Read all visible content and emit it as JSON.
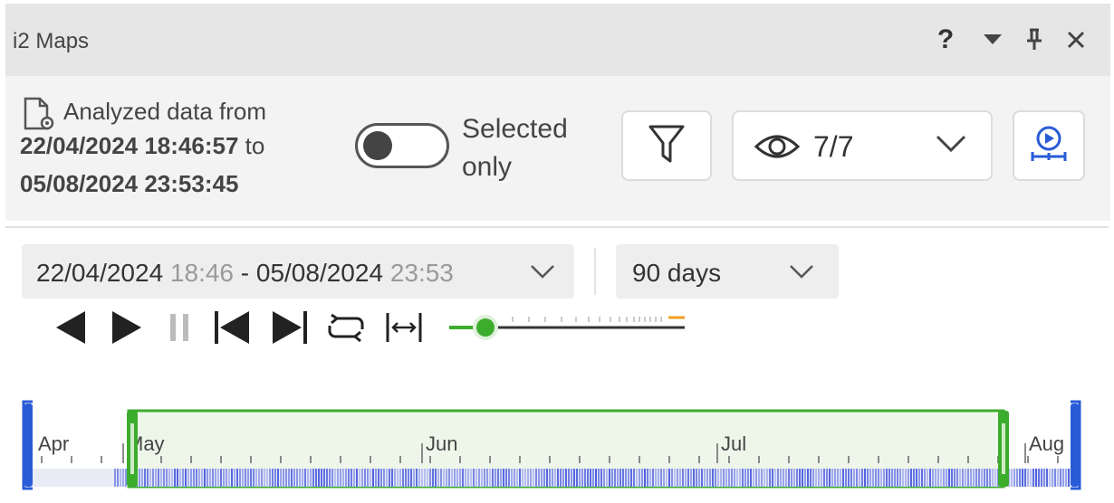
{
  "window": {
    "title": "i2 Maps",
    "help_label": "?"
  },
  "header": {
    "analyzed_prefix": "Analyzed data from",
    "start": "22/04/2024 18:46:57",
    "to_label": "to",
    "end": "05/08/2024 23:53:45",
    "selected_only_label": "Selected only",
    "selected_only_on": false,
    "visible_layers": "7/7"
  },
  "timeline": {
    "range_start_date": "22/04/2024",
    "range_start_time": "18:46",
    "range_separator": "- 05/08/2024",
    "range_end_time": "23:53",
    "duration": "90 days",
    "month_labels": [
      "Apr",
      "May",
      "Jun",
      "Jul",
      "Aug"
    ],
    "colors": {
      "selection": "#3cac2c",
      "bounds": "#2a5bd7",
      "density": "#5b6fe0",
      "speed_marker": "#f0a020"
    }
  }
}
